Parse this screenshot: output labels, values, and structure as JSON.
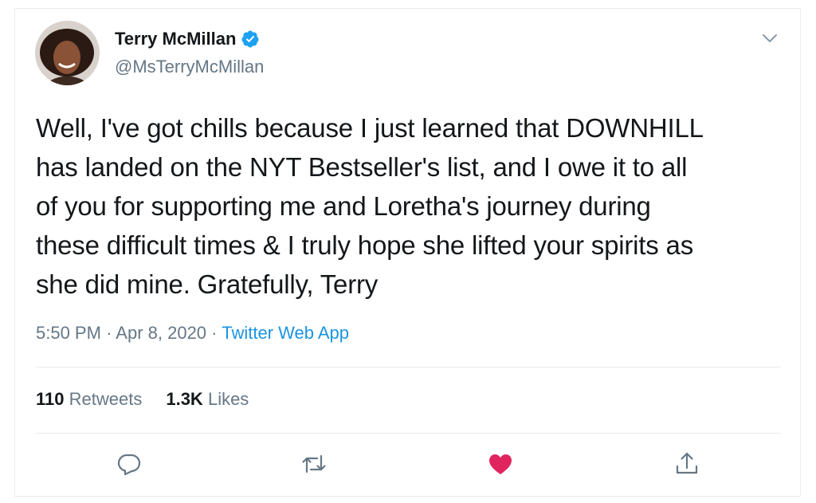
{
  "user": {
    "name": "Terry McMillan",
    "handle": "@MsTerryMcMillan"
  },
  "tweet": {
    "lines": [
      "Well, I've got chills because I just learned that DOWNHILL",
      "has landed on the NYT Bestseller's list, and I owe it to all",
      "of you for supporting me and Loretha's journey during",
      "these difficult times & I truly hope she lifted your spirits as",
      "she did mine. Gratefully, Terry"
    ]
  },
  "meta": {
    "time": "5:50 PM",
    "sep1": "·",
    "date": "Apr 8, 2020",
    "sep2": "·",
    "source": "Twitter Web App"
  },
  "stats": {
    "retweets_count": "110",
    "retweets_label": "Retweets",
    "likes_count": "1.3K",
    "likes_label": "Likes"
  },
  "colors": {
    "accent": "#1b95e0",
    "like": "#e0245e",
    "muted": "#657786"
  },
  "icons": [
    "verified-badge-icon",
    "chevron-down-icon",
    "reply-icon",
    "retweet-icon",
    "like-icon",
    "share-icon"
  ]
}
